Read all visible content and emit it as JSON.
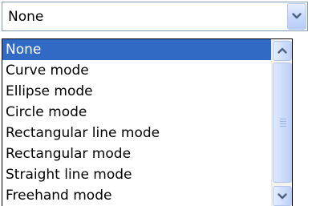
{
  "combo": {
    "selected_value": "None",
    "dropdown_icon": "chevron-down-icon"
  },
  "dropdown": {
    "items": [
      {
        "label": "None",
        "selected": true
      },
      {
        "label": "Curve mode",
        "selected": false
      },
      {
        "label": "Ellipse mode",
        "selected": false
      },
      {
        "label": "Circle mode",
        "selected": false
      },
      {
        "label": "Rectangular line mode",
        "selected": false
      },
      {
        "label": "Rectangular mode",
        "selected": false
      },
      {
        "label": "Straight line mode",
        "selected": false
      },
      {
        "label": "Freehand mode",
        "selected": false
      }
    ],
    "scrollbar": {
      "up_icon": "chevron-up-icon",
      "down_icon": "chevron-down-icon",
      "thumb_icon": "grip-icon"
    }
  },
  "colors": {
    "selection": "#316ac5",
    "selection_text": "#ffffff",
    "border": "#7f9db9",
    "arrow": "#4d6185"
  }
}
